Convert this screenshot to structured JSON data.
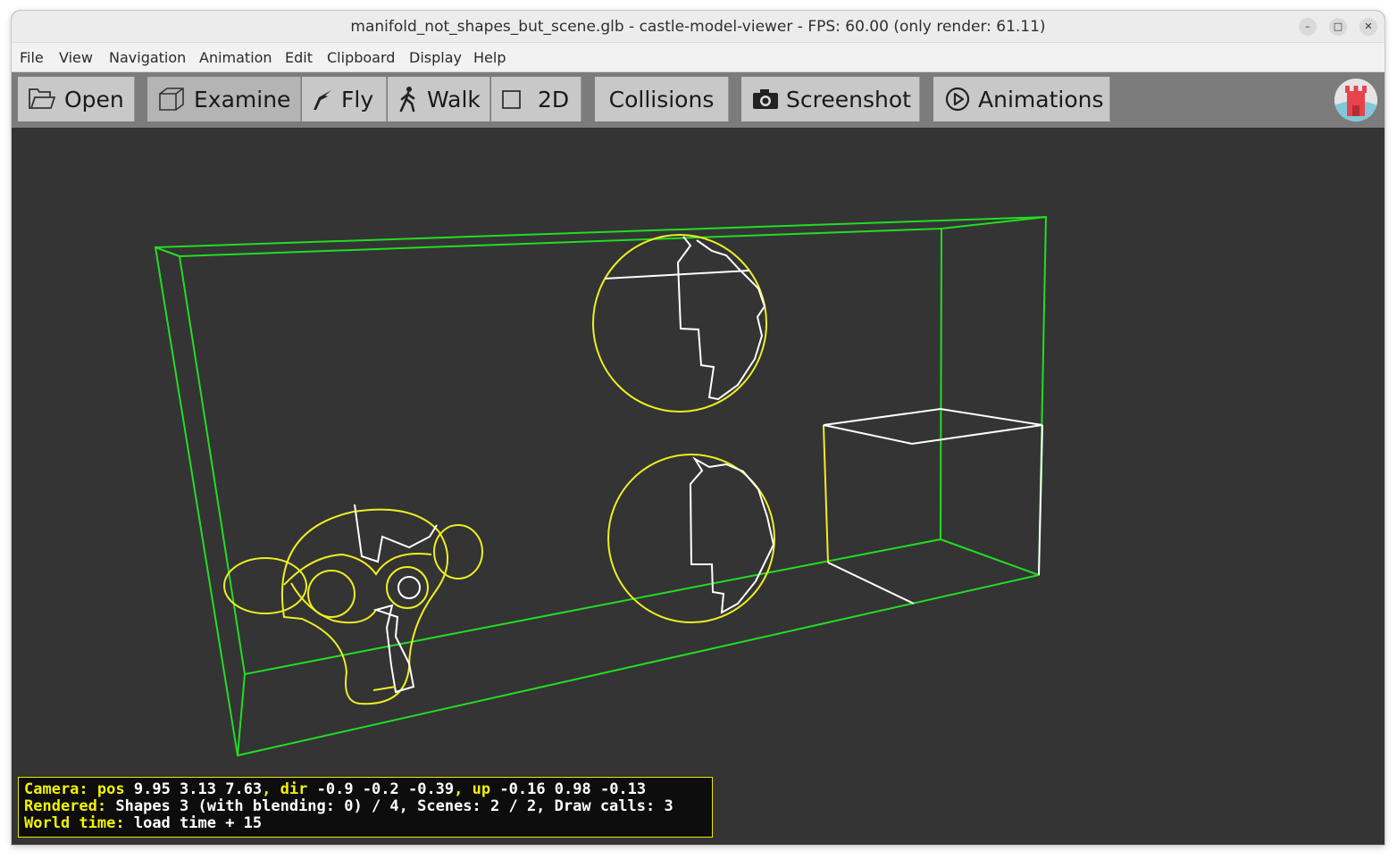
{
  "window": {
    "title": "manifold_not_shapes_but_scene.glb - castle-model-viewer - FPS: 60.00 (only render: 61.11)",
    "controls": {
      "minimize": "–",
      "maximize": "□",
      "close": "✕"
    }
  },
  "menubar": {
    "items": [
      "File",
      "View",
      "Navigation",
      "Animation",
      "Edit",
      "Clipboard",
      "Display",
      "Help"
    ]
  },
  "toolbar": {
    "open": {
      "label": "Open",
      "icon": "folder-open-icon"
    },
    "examine": {
      "label": "Examine",
      "icon": "cube-icon",
      "active": true
    },
    "fly": {
      "label": "Fly",
      "icon": "fly-icon"
    },
    "walk": {
      "label": "Walk",
      "icon": "walk-icon"
    },
    "two_d": {
      "label": "2D",
      "icon": "square-icon"
    },
    "collisions": {
      "label": "Collisions"
    },
    "screenshot": {
      "label": "Screenshot",
      "icon": "camera-icon"
    },
    "animations": {
      "label": "Animations",
      "icon": "play-circle-icon"
    },
    "logo": {
      "icon": "castle-logo-icon"
    }
  },
  "colors": {
    "bbox_scene": "#22dd22",
    "wire_selected": "#eeee22",
    "wire_edge": "#ffffff",
    "viewport_bg": "#343434",
    "hud_key": "#f2f200"
  },
  "hud": {
    "camera_key": "Camera:",
    "pos_key": "pos",
    "pos_val": "9.95 3.13 7.63",
    "dir_key": "dir",
    "dir_val": "-0.9 -0.2 -0.39",
    "up_key": "up",
    "up_val": "-0.16 0.98 -0.13",
    "rendered_key": "Rendered:",
    "rendered_val": "Shapes 3 (with blending: 0) / 4, Scenes: 2 / 2, Draw calls: 3",
    "world_key": "World time:",
    "world_val": "load time + 15"
  }
}
